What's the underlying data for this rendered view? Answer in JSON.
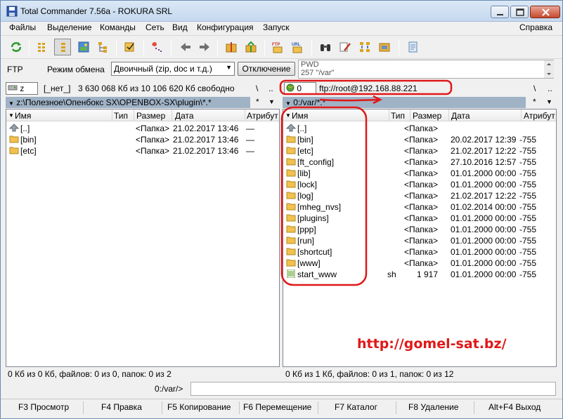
{
  "window": {
    "title": "Total Commander 7.56a - ROKURA SRL"
  },
  "menu": {
    "items": [
      "Файлы",
      "Выделение",
      "Команды",
      "Сеть",
      "Вид",
      "Конфигурация",
      "Запуск"
    ],
    "help": "Справка"
  },
  "ftp": {
    "label": "FTP",
    "mode_label": "Режим обмена",
    "mode_value": "Двоичный (zip, doc и т.д.)",
    "disconnect": "Отключение",
    "log": [
      "PWD",
      "257 \"/var\""
    ]
  },
  "left": {
    "drive": "z",
    "volume": "[_нет_]",
    "free": "3 630 068 Кб из 10 106 620 Кб свободно",
    "root_btn": "\\",
    "up_btn": "..",
    "path": "z:\\Полезное\\Опенбокс SX\\OPENBOX-SX\\plugin\\*.*",
    "path_star": "*",
    "columns": {
      "name": "Имя",
      "type": "Тип",
      "size": "Размер",
      "date": "Дата",
      "attr": "Атрибут"
    },
    "files": [
      {
        "name": "[..]",
        "type": "",
        "size": "<Папка>",
        "date": "21.02.2017 13:46",
        "attr": "—",
        "icon": "up-icon"
      },
      {
        "name": "[bin]",
        "type": "",
        "size": "<Папка>",
        "date": "21.02.2017 13:46",
        "attr": "—",
        "icon": "folder-icon"
      },
      {
        "name": "[etc]",
        "type": "",
        "size": "<Папка>",
        "date": "21.02.2017 13:46",
        "attr": "—",
        "icon": "folder-icon"
      }
    ],
    "status": "0 Кб из 0 Кб, файлов: 0 из 0, папок: 0 из 2"
  },
  "right": {
    "drive": "0",
    "connection": "ftp://root@192.168.88.221",
    "root_btn": "\\",
    "up_btn": "..",
    "path": "0:/var/*.*",
    "path_star": "*",
    "columns": {
      "name": "Имя",
      "type": "Тип",
      "size": "Размер",
      "date": "Дата",
      "attr": "Атрибут"
    },
    "files": [
      {
        "name": "[..]",
        "type": "",
        "size": "<Папка>",
        "date": "",
        "attr": "",
        "icon": "up-icon"
      },
      {
        "name": "[bin]",
        "type": "",
        "size": "<Папка>",
        "date": "20.02.2017 12:39",
        "attr": "-755",
        "icon": "folder-icon"
      },
      {
        "name": "[etc]",
        "type": "",
        "size": "<Папка>",
        "date": "21.02.2017 12:22",
        "attr": "-755",
        "icon": "folder-icon"
      },
      {
        "name": "[ft_config]",
        "type": "",
        "size": "<Папка>",
        "date": "27.10.2016 12:57",
        "attr": "-755",
        "icon": "folder-icon"
      },
      {
        "name": "[lib]",
        "type": "",
        "size": "<Папка>",
        "date": "01.01.2000 00:00",
        "attr": "-755",
        "icon": "folder-icon"
      },
      {
        "name": "[lock]",
        "type": "",
        "size": "<Папка>",
        "date": "01.01.2000 00:00",
        "attr": "-755",
        "icon": "folder-icon"
      },
      {
        "name": "[log]",
        "type": "",
        "size": "<Папка>",
        "date": "21.02.2017 12:22",
        "attr": "-755",
        "icon": "folder-icon"
      },
      {
        "name": "[mheg_nvs]",
        "type": "",
        "size": "<Папка>",
        "date": "01.02.2014 00:00",
        "attr": "-755",
        "icon": "folder-icon"
      },
      {
        "name": "[plugins]",
        "type": "",
        "size": "<Папка>",
        "date": "01.01.2000 00:00",
        "attr": "-755",
        "icon": "folder-icon"
      },
      {
        "name": "[ppp]",
        "type": "",
        "size": "<Папка>",
        "date": "01.01.2000 00:00",
        "attr": "-755",
        "icon": "folder-icon"
      },
      {
        "name": "[run]",
        "type": "",
        "size": "<Папка>",
        "date": "01.01.2000 00:00",
        "attr": "-755",
        "icon": "folder-icon"
      },
      {
        "name": "[shortcut]",
        "type": "",
        "size": "<Папка>",
        "date": "01.01.2000 00:00",
        "attr": "-755",
        "icon": "folder-icon"
      },
      {
        "name": "[www]",
        "type": "",
        "size": "<Папка>",
        "date": "01.01.2000 00:00",
        "attr": "-755",
        "icon": "folder-icon"
      },
      {
        "name": "start_www",
        "type": "sh",
        "size": "1 917",
        "date": "01.01.2000 00:00",
        "attr": "-755",
        "icon": "script-file-icon"
      }
    ],
    "status": "0 Кб из 1 Кб, файлов: 0 из 1, папок: 0 из 12"
  },
  "command_line": {
    "prompt": "0:/var/>"
  },
  "function_keys": [
    "F3 Просмотр",
    "F4 Правка",
    "F5 Копирование",
    "F6 Перемещение",
    "F7 Каталог",
    "F8 Удаление",
    "Alt+F4 Выход"
  ],
  "watermark": "http://gomel-sat.bz/",
  "colors": {
    "annotation_red": "#e01818",
    "path_bar": "#9fb2c6",
    "folder": "#f2c14e"
  }
}
